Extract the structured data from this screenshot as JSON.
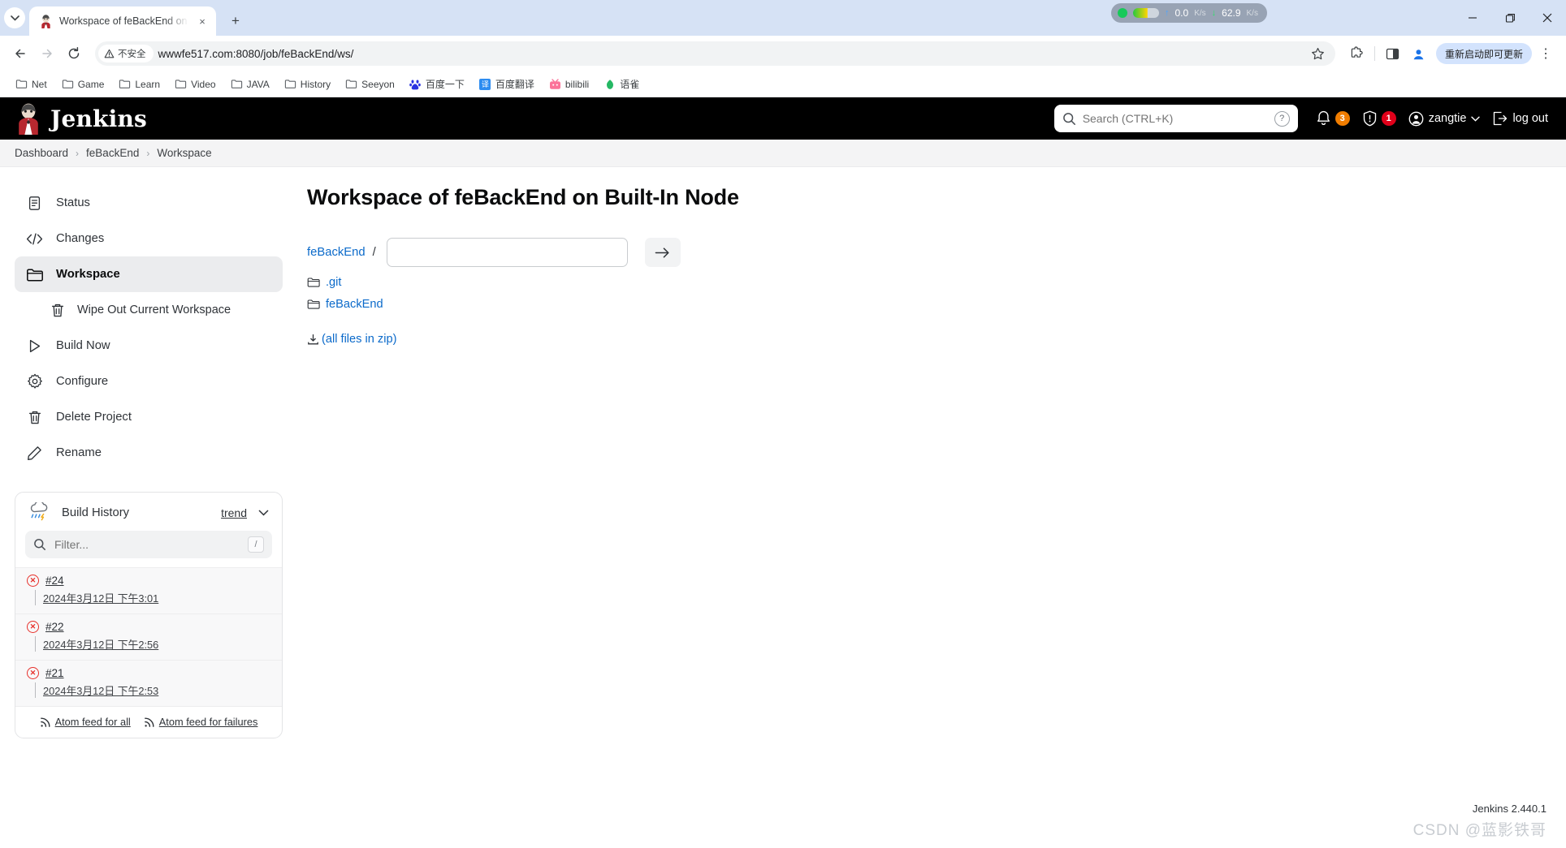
{
  "browser": {
    "tab": {
      "title": "Workspace of feBackEnd on B",
      "favicon": "jenkins-butler-icon",
      "close_label": "×"
    },
    "new_tab_label": "+",
    "tab_list_chevron": "⌄",
    "nav": {
      "back": "←",
      "forward": "→",
      "reload": "⟳"
    },
    "security": {
      "icon": "warning-triangle-icon",
      "label": "不安全"
    },
    "url": "wwwfe517.com:8080/job/feBackEnd/ws/",
    "actions": {
      "bookmark_star": "☆",
      "extensions": "extensions-puzzle-icon",
      "split_view": "split-screen-icon",
      "profile": "profile-avatar-icon",
      "update_label": "重新启动即可更新",
      "menu": "⋮"
    },
    "window": {
      "minimize": "—",
      "maximize": "❐",
      "close": "✕"
    },
    "net_meter": {
      "up_arrow": "↑",
      "up_value": "0.0",
      "up_unit": "K/s",
      "down_arrow": "↓",
      "down_value": "62.9",
      "down_unit": "K/s"
    },
    "bookmarks": [
      {
        "label": "Net",
        "icon": "folder-icon",
        "type": "folder"
      },
      {
        "label": "Game",
        "icon": "folder-icon",
        "type": "folder"
      },
      {
        "label": "Learn",
        "icon": "folder-icon",
        "type": "folder"
      },
      {
        "label": "Video",
        "icon": "folder-icon",
        "type": "folder"
      },
      {
        "label": "JAVA",
        "icon": "folder-icon",
        "type": "folder"
      },
      {
        "label": "History",
        "icon": "folder-icon",
        "type": "folder"
      },
      {
        "label": "Seeyon",
        "icon": "folder-icon",
        "type": "folder"
      },
      {
        "label": "百度一下",
        "icon": "baidu-icon",
        "type": "site",
        "color": "#2932e1",
        "glyph": "熊"
      },
      {
        "label": "百度翻译",
        "icon": "baidu-translate-icon",
        "type": "site",
        "color": "#2d8cf0",
        "glyph": "译"
      },
      {
        "label": "bilibili",
        "icon": "bilibili-icon",
        "type": "site",
        "color": "#fb7299",
        "glyph": "■"
      },
      {
        "label": "语雀",
        "icon": "yuque-icon",
        "type": "site",
        "color": "#25b864",
        "glyph": "●"
      }
    ]
  },
  "jenkins": {
    "logo_text": "Jenkins",
    "search": {
      "placeholder": "Search (CTRL+K)",
      "icon": "search-icon",
      "help_icon": "question-mark-icon",
      "help_label": "?"
    },
    "notifications": {
      "icon": "bell-icon",
      "count": "3",
      "color": "#f07d00"
    },
    "security_alerts": {
      "icon": "shield-warning-icon",
      "count": "1",
      "color": "#e0001a"
    },
    "user": {
      "name": "zangtie",
      "icon": "user-circle-icon",
      "chevron": "⌄"
    },
    "logout": {
      "label": "log out",
      "icon": "logout-icon"
    },
    "breadcrumbs": [
      {
        "label": "Dashboard"
      },
      {
        "label": "feBackEnd"
      },
      {
        "label": "Workspace"
      }
    ],
    "breadcrumb_separator": "›",
    "sidebar": [
      {
        "label": "Status",
        "icon": "document-icon",
        "active": false,
        "sub": false
      },
      {
        "label": "Changes",
        "icon": "code-brackets-icon",
        "active": false,
        "sub": false
      },
      {
        "label": "Workspace",
        "icon": "folder-icon",
        "active": true,
        "sub": false
      },
      {
        "label": "Wipe Out Current Workspace",
        "icon": "trash-icon",
        "active": false,
        "sub": true
      },
      {
        "label": "Build Now",
        "icon": "play-triangle-icon",
        "active": false,
        "sub": false
      },
      {
        "label": "Configure",
        "icon": "gear-icon",
        "active": false,
        "sub": false
      },
      {
        "label": "Delete Project",
        "icon": "trash-icon",
        "active": false,
        "sub": false
      },
      {
        "label": "Rename",
        "icon": "pencil-icon",
        "active": false,
        "sub": false
      }
    ],
    "build_history": {
      "title": "Build History",
      "icon": "weather-storm-icon",
      "trend_label": "trend",
      "trend_chevron": "⌄",
      "filter_placeholder": "Filter...",
      "filter_icon": "search-icon",
      "filter_shortcut": "/",
      "builds": [
        {
          "number": "#24",
          "date": "2024年3月12日 下午3:01",
          "status": "failed",
          "status_icon": "error-circle-icon"
        },
        {
          "number": "#22",
          "date": "2024年3月12日 下午2:56",
          "status": "failed",
          "status_icon": "error-circle-icon"
        },
        {
          "number": "#21",
          "date": "2024年3月12日 下午2:53",
          "status": "failed",
          "status_icon": "error-circle-icon"
        }
      ],
      "feeds": [
        {
          "label": "Atom feed for all",
          "icon": "rss-icon"
        },
        {
          "label": "Atom feed for failures",
          "icon": "rss-icon"
        }
      ]
    },
    "main": {
      "title": "Workspace of feBackEnd on Built-In Node",
      "path_prefix": "feBackEnd",
      "path_separator": "/",
      "path_value": "",
      "path_placeholder": "",
      "go_button_icon": "arrow-right-icon",
      "go_button_label": "→",
      "files": [
        {
          "label": ".git",
          "icon": "folder-icon"
        },
        {
          "label": "feBackEnd",
          "icon": "folder-icon"
        }
      ],
      "zip_link": {
        "label": "(all files in zip)",
        "icon": "download-icon"
      }
    },
    "footer": {
      "version": "Jenkins 2.440.1",
      "watermark": "CSDN @蓝影铁哥"
    }
  }
}
